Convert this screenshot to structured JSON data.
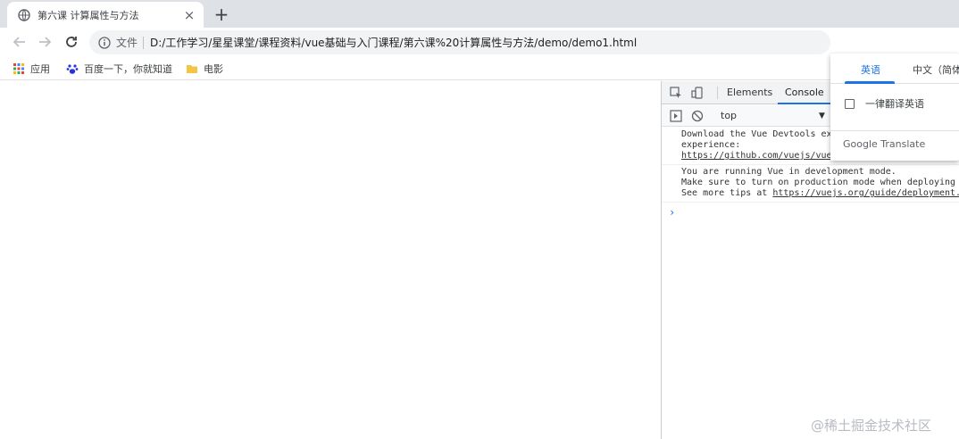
{
  "tab": {
    "title": "第六课 计算属性与方法",
    "close_label": "×",
    "new_tab_label": "+"
  },
  "toolbar": {
    "scheme_label": "文件",
    "url": "D:/工作学习/星星课堂/课程资料/vue基础与入门课程/第六课%20计算属性与方法/demo/demo1.html"
  },
  "bookmarks": [
    {
      "label": "应用",
      "icon": "apps-grid-icon"
    },
    {
      "label": "百度一下，你就知道",
      "icon": "baidu-paw-icon"
    },
    {
      "label": "电影",
      "icon": "folder-icon"
    }
  ],
  "devtools": {
    "tabs": [
      "Elements",
      "Console"
    ],
    "active_tab": "Console",
    "context": "top",
    "messages": [
      {
        "lines": [
          "Download the Vue Devtools ex",
          "experience:"
        ],
        "link": "https://github.com/vuejs/vue-devtools"
      },
      {
        "lines": [
          "You are running Vue in development mode.",
          "Make sure to turn on production mode when deploying",
          "See more tips at "
        ],
        "link": "https://vuejs.org/guide/deployment."
      }
    ],
    "prompt": "›"
  },
  "translate": {
    "tabs": [
      "英语",
      "中文（简体"
    ],
    "active_tab": "英语",
    "option_label": "一律翻译英语",
    "footer": "Google Translate"
  },
  "watermark": "@稀土掘金技术社区",
  "colors": {
    "accent": "#1a73e8",
    "tabstrip": "#dee1e6",
    "omnibox": "#f1f3f4"
  }
}
